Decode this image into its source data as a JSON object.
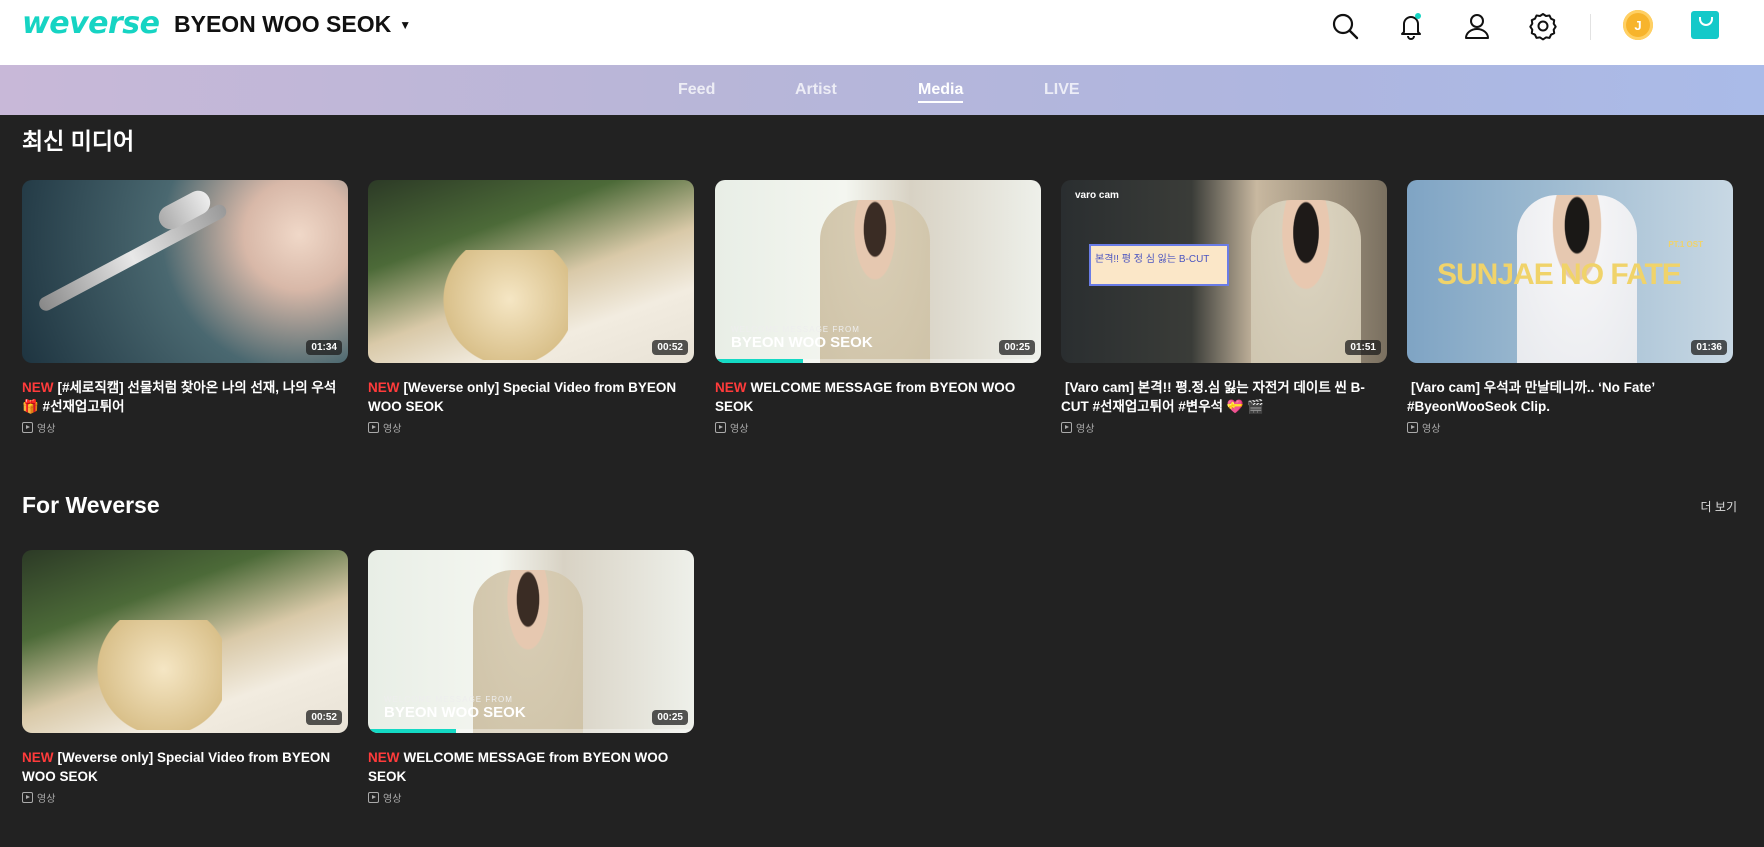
{
  "header": {
    "logo": "weverse",
    "community_name": "BYEON WOO SEOK",
    "jelly_label": "J"
  },
  "tabs": [
    {
      "label": "Feed",
      "active": false
    },
    {
      "label": "Artist",
      "active": false
    },
    {
      "label": "Media",
      "active": true
    },
    {
      "label": "LIVE",
      "active": false
    }
  ],
  "sections": {
    "latest": {
      "title": "최신 미디어",
      "cards": [
        {
          "new": "NEW",
          "title": "[#세로직캠] 선물처럼 찾아온 나의 선재, 나의 우석 🎁 #선재업고튀어",
          "duration": "01:34",
          "type": "영상"
        },
        {
          "new": "NEW",
          "title": "[Weverse only] Special Video from BYEON WOO SEOK",
          "duration": "00:52",
          "type": "영상"
        },
        {
          "new": "NEW",
          "title": "WELCOME MESSAGE from BYEON WOO SEOK",
          "duration": "00:25",
          "type": "영상",
          "progress": 0.27,
          "overlay_small": "WELCOME MESSAGE FROM",
          "overlay_big": "BYEON WOO SEOK"
        },
        {
          "new": "",
          "title": "[Varo cam] 본격!! 평.정.심 잃는 자전거 데이트 씬 B-CUT #선재업고튀어 #변우석 💝 🎬",
          "duration": "01:51",
          "type": "영상",
          "overlay_small": "varo cam",
          "overlay_big": "본격!! 평 정 심 잃는 B-CUT"
        },
        {
          "new": "",
          "title": "[Varo cam] 우석과 만날테니까.. ‘No Fate’ #ByeonWooSeok Clip.",
          "duration": "01:36",
          "type": "영상",
          "overlay_small": "PT.1 OST",
          "overlay_big": "SUNJAE NO FATE"
        }
      ]
    },
    "for_weverse": {
      "title": "For Weverse",
      "more_label": "더 보기",
      "cards": [
        {
          "new": "NEW",
          "title": "[Weverse only] Special Video from BYEON WOO SEOK",
          "duration": "00:52",
          "type": "영상"
        },
        {
          "new": "NEW",
          "title": "WELCOME MESSAGE from BYEON WOO SEOK",
          "duration": "00:25",
          "type": "영상",
          "progress": 0.27,
          "overlay_small": "WELCOME MESSAGE FROM",
          "overlay_big": "BYEON WOO SEOK"
        }
      ]
    }
  },
  "colors": {
    "brand": "#16d4c3",
    "new_badge": "#ff3b3b",
    "progress": "#14d9c4",
    "background": "#222222"
  }
}
